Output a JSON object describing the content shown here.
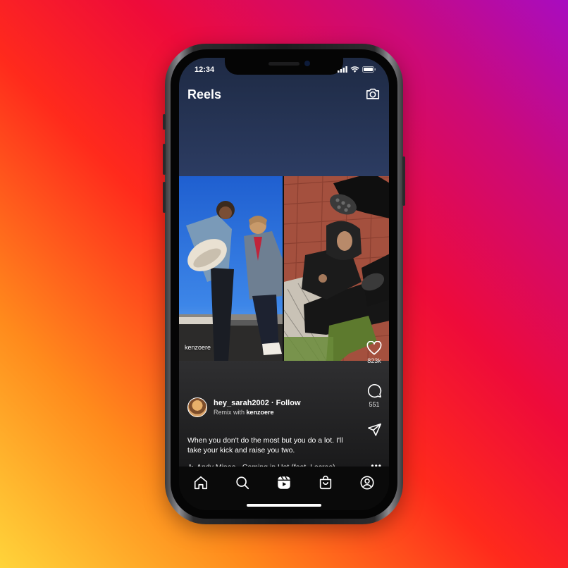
{
  "status": {
    "time": "12:34"
  },
  "header": {
    "title": "Reels"
  },
  "reel": {
    "source_user": "kenzoere",
    "likes": "823k",
    "comments": "551",
    "author": {
      "username_follow": "hey_sarah2002 · Follow",
      "remix_prefix": "Remix with",
      "remix_user": "kenzoere"
    },
    "caption": "When you don't do the most but you do a lot. I'll take your kick and raise you two.",
    "music": "Andy Mineo · Coming in Hot (feat. Lecrae)",
    "more": "•••"
  },
  "nav": [
    "home-icon",
    "search-icon",
    "reels-icon",
    "shop-icon",
    "profile-icon"
  ],
  "colors": {
    "background_gradient": [
      "#ffd43a",
      "#ff8a1c",
      "#ff2a1c",
      "#ee0b3a",
      "#cc0a78",
      "#a80cc0"
    ],
    "screen_top": "#1e2a44",
    "nav_bg": "#0a0a0a"
  }
}
